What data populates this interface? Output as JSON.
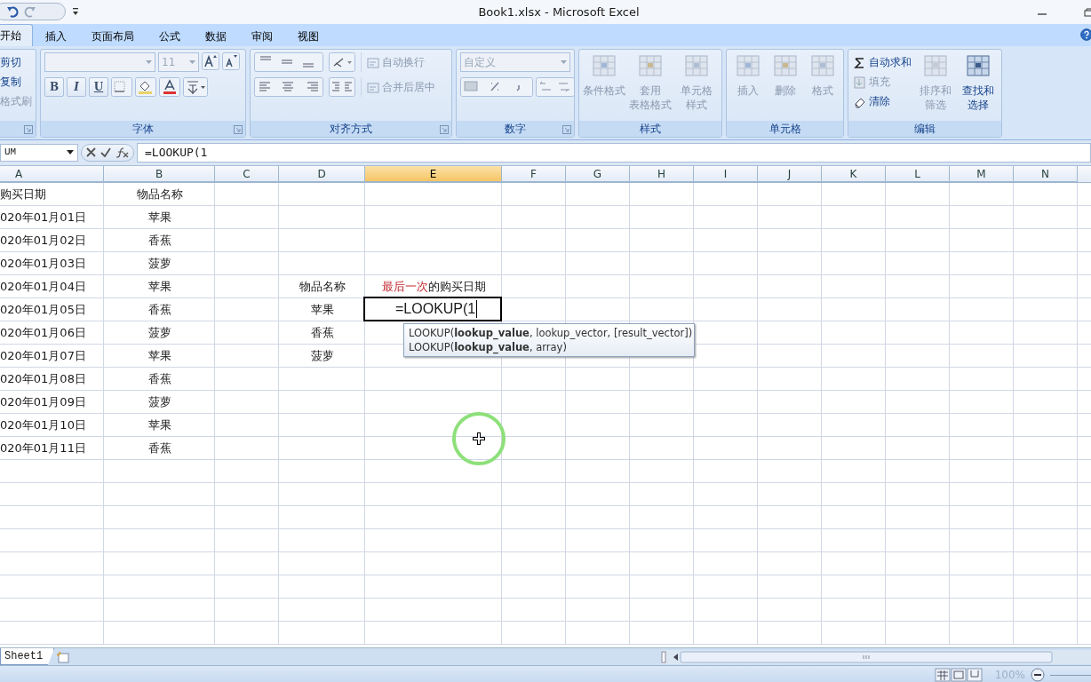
{
  "window": {
    "title": "Book1.xlsx - Microsoft Excel"
  },
  "tabs": [
    {
      "label": "开始",
      "selected": true
    },
    {
      "label": "插入",
      "selected": false
    },
    {
      "label": "页面布局",
      "selected": false
    },
    {
      "label": "公式",
      "selected": false
    },
    {
      "label": "数据",
      "selected": false
    },
    {
      "label": "审阅",
      "selected": false
    },
    {
      "label": "视图",
      "selected": false
    }
  ],
  "ribbon": {
    "groups": [
      {
        "kind": "clipboard",
        "items": [
          {
            "label": "剪切",
            "disabled": false
          },
          {
            "label": "复制",
            "disabled": false
          },
          {
            "label": "格式刷",
            "disabled": true
          }
        ]
      },
      {
        "kind": "font",
        "label": "字体",
        "font_size": "11",
        "format_buttons": [
          "B",
          "I",
          "U"
        ]
      },
      {
        "kind": "alignment",
        "label": "对齐方式",
        "items": [
          {
            "label": "自动换行",
            "disabled": true
          },
          {
            "label": "合并后居中",
            "disabled": true
          }
        ]
      },
      {
        "kind": "number",
        "label": "数字",
        "format": "自定义"
      },
      {
        "kind": "large",
        "label": "样式",
        "items": [
          {
            "lines": [
              "条件格式"
            ],
            "disabled": true
          },
          {
            "lines": [
              "套用",
              "表格格式"
            ],
            "disabled": true
          },
          {
            "lines": [
              "单元格",
              "样式"
            ],
            "disabled": true
          }
        ]
      },
      {
        "kind": "large",
        "label": "单元格",
        "items": [
          {
            "lines": [
              "插入"
            ],
            "disabled": true
          },
          {
            "lines": [
              "删除"
            ],
            "disabled": true
          },
          {
            "lines": [
              "格式"
            ],
            "disabled": true
          }
        ]
      },
      {
        "kind": "editing",
        "label": "编辑",
        "items": [
          {
            "label": "自动求和",
            "disabled": false
          },
          {
            "label": "填充",
            "disabled": true
          },
          {
            "label": "清除",
            "disabled": false
          }
        ],
        "large": [
          {
            "lines": [
              "排序和",
              "筛选"
            ],
            "disabled": true
          },
          {
            "lines": [
              "查找和",
              "选择"
            ],
            "disabled": false
          }
        ]
      }
    ]
  },
  "formula_bar": {
    "name_box": "UM",
    "formula": "=LOOKUP(1"
  },
  "sheet": {
    "columns": [
      {
        "label": "A",
        "selected": false
      },
      {
        "label": "B",
        "selected": false
      },
      {
        "label": "C",
        "selected": false
      },
      {
        "label": "D",
        "selected": false
      },
      {
        "label": "E",
        "selected": true
      },
      {
        "label": "F",
        "selected": false
      },
      {
        "label": "G",
        "selected": false
      },
      {
        "label": "H",
        "selected": false
      },
      {
        "label": "I",
        "selected": false
      },
      {
        "label": "J",
        "selected": false
      },
      {
        "label": "K",
        "selected": false
      },
      {
        "label": "L",
        "selected": false
      },
      {
        "label": "M",
        "selected": false
      },
      {
        "label": "N",
        "selected": false
      }
    ],
    "rows": [
      {
        "A": "购买日期",
        "B": "物品名称"
      },
      {
        "A": "020年01月01日",
        "B": "苹果"
      },
      {
        "A": "020年01月02日",
        "B": "香蕉"
      },
      {
        "A": "020年01月03日",
        "B": "菠萝"
      },
      {
        "A": "020年01月04日",
        "B": "苹果",
        "D": "物品名称",
        "E": {
          "runs": [
            {
              "text": "最后一次",
              "emphasis": true
            },
            {
              "text": "的购买日期",
              "emphasis": false
            }
          ]
        }
      },
      {
        "A": "020年01月05日",
        "B": "香蕉",
        "D": "苹果",
        "E": {
          "text": "=LOOKUP(1",
          "editing": true
        }
      },
      {
        "A": "020年01月06日",
        "B": "菠萝",
        "D": "香蕉"
      },
      {
        "A": "020年01月07日",
        "B": "苹果",
        "D": "菠萝"
      },
      {
        "A": "020年01月08日",
        "B": "香蕉"
      },
      {
        "A": "020年01月09日",
        "B": "菠萝"
      },
      {
        "A": "020年01月10日",
        "B": "苹果"
      },
      {
        "A": "020年01月11日",
        "B": "香蕉"
      }
    ]
  },
  "formula_tooltip": {
    "lines": [
      "LOOKUP(**lookup_value**, lookup_vector, [result_vector])",
      "LOOKUP(**lookup_value**, array)"
    ]
  },
  "sheet_tabs": [
    {
      "label": "Sheet1",
      "selected": true
    }
  ],
  "status_bar": {
    "zoom": "100%"
  }
}
